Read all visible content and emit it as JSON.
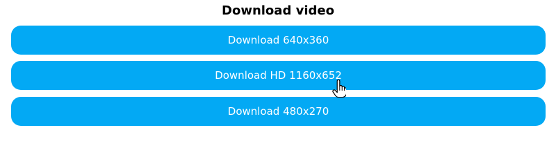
{
  "section": {
    "title": "Download video"
  },
  "downloads": [
    {
      "label": "Download 640x360"
    },
    {
      "label": "Download HD 1160x652"
    },
    {
      "label": "Download 480x270"
    }
  ],
  "colors": {
    "button_bg": "#03a9f4",
    "button_text": "#ffffff",
    "title_text": "#000000"
  },
  "cursor": {
    "icon": "hand-pointer-icon"
  }
}
